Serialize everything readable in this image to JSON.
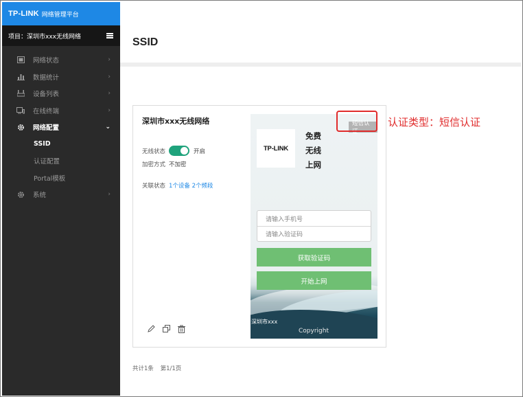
{
  "brand": {
    "logo": "TP-LINK",
    "platform": "网络管理平台"
  },
  "project": {
    "label": "项目：深圳市xxx无线网络"
  },
  "nav": {
    "items": [
      {
        "label": "网络状态",
        "icon": "monitor-icon"
      },
      {
        "label": "数据统计",
        "icon": "bar-chart-icon"
      },
      {
        "label": "设备列表",
        "icon": "device-icon"
      },
      {
        "label": "在线终端",
        "icon": "terminal-icon"
      },
      {
        "label": "网络配置",
        "icon": "gear-icon"
      }
    ],
    "sub_items": [
      "SSID",
      "认证配置",
      "Portal模板"
    ],
    "last_item": {
      "label": "系统",
      "icon": "gear-icon"
    }
  },
  "page": {
    "title": "SSID"
  },
  "card": {
    "title": "深圳市xxx无线网络",
    "wireless_label": "无线状态",
    "wireless_value": "开启",
    "encrypt_label": "加密方式",
    "encrypt_value": "不加密",
    "assoc_label": "关联状态",
    "assoc_value": "1个设备 2个频段"
  },
  "preview": {
    "badge": "短信认证",
    "logo": "TP-LINK",
    "slogan": [
      "免费",
      "无线",
      "上网"
    ],
    "phone_placeholder": "请输入手机号",
    "code_placeholder": "请输入验证码",
    "get_code_button": "获取验证码",
    "start_button": "开始上网",
    "footer_name": "深圳市xxx",
    "copyright": "Copyright"
  },
  "annotation": {
    "text": "认证类型：短信认证",
    "color": "#e02b2b"
  },
  "pager": {
    "total": "共计1条",
    "page": "第1/1页"
  },
  "colors": {
    "brand_blue": "#1e88e5",
    "toggle_green": "#1fa37c",
    "button_green": "#6fbf73",
    "sidebar": "#2a2a2a"
  }
}
